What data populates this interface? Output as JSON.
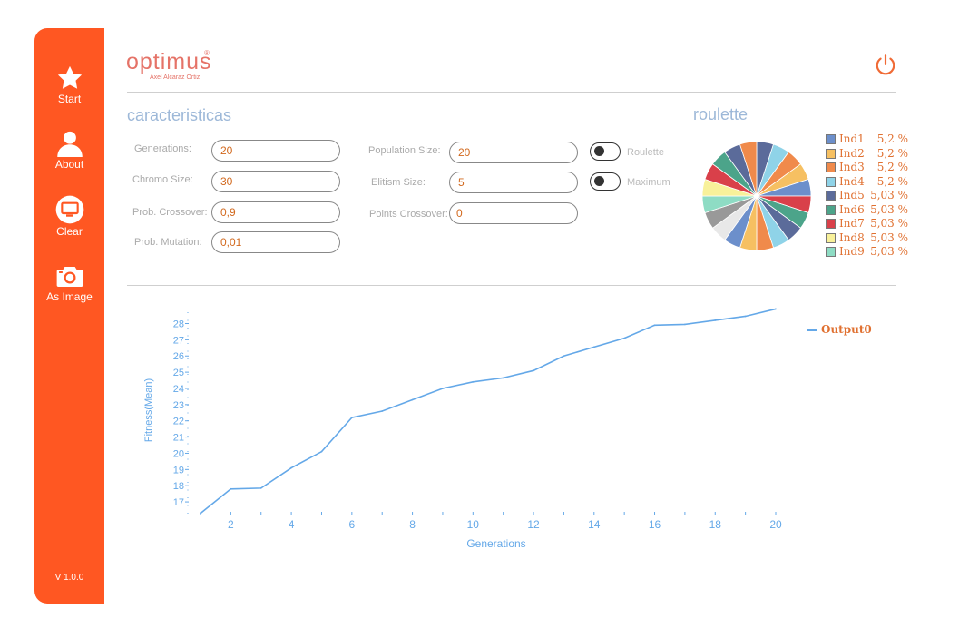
{
  "sidebar": {
    "items": [
      {
        "label": "Start",
        "icon": "star-icon"
      },
      {
        "label": "About",
        "icon": "user-icon"
      },
      {
        "label": "Clear",
        "icon": "monitor-icon"
      },
      {
        "label": "As Image",
        "icon": "camera-icon"
      }
    ],
    "version": "V 1.0.0"
  },
  "header": {
    "logo_text": "optimus",
    "logo_sub": "Axel Alcaraz Ortiz",
    "logo_reg": "®",
    "power_icon": "power-icon"
  },
  "caracteristicas": {
    "title": "caracteristicas",
    "generations": {
      "label": "Generations:",
      "value": "20"
    },
    "chromo_size": {
      "label": "Chromo Size:",
      "value": "30"
    },
    "prob_crossover": {
      "label": "Prob. Crossover:",
      "value": "0,9"
    },
    "prob_mutation": {
      "label": "Prob. Mutation:",
      "value": "0,01"
    },
    "population_size": {
      "label": "Population Size:",
      "value": "20"
    },
    "elitism_size": {
      "label": "Elitism Size:",
      "value": "5"
    },
    "points_crossover": {
      "label": "Points Crossover:",
      "value": "0"
    },
    "roulette_toggle": {
      "label": "Roulette",
      "on": false
    },
    "maximum_toggle": {
      "label": "Maximum",
      "on": false
    }
  },
  "roulette": {
    "title": "roulette",
    "legend": [
      {
        "name": "Ind1",
        "value": "5,2 %",
        "color": "#6C8FCB"
      },
      {
        "name": "Ind2",
        "value": "5,2 %",
        "color": "#F6C062"
      },
      {
        "name": "Ind3",
        "value": "5,2 %",
        "color": "#F08A4B"
      },
      {
        "name": "Ind4",
        "value": "5,2 %",
        "color": "#8FD3E8"
      },
      {
        "name": "Ind5",
        "value": "5,03 %",
        "color": "#5B6B9A"
      },
      {
        "name": "Ind6",
        "value": "5,03 %",
        "color": "#4CA48A"
      },
      {
        "name": "Ind7",
        "value": "5,03 %",
        "color": "#D9404A"
      },
      {
        "name": "Ind8",
        "value": "5,03 %",
        "color": "#F8F19A"
      },
      {
        "name": "Ind9",
        "value": "5,03 %",
        "color": "#8EDCC4"
      }
    ],
    "pie_colors": [
      "#5B6B9A",
      "#8FD3E8",
      "#F08A4B",
      "#F6C062",
      "#6C8FCB",
      "#D9404A",
      "#4CA48A",
      "#5B6B9A",
      "#8FD3E8",
      "#F08A4B",
      "#F6C062",
      "#6C8FCB",
      "#E8E8E8",
      "#999999",
      "#8EDCC4",
      "#F8F19A",
      "#D9404A",
      "#4CA48A",
      "#5B6B9A",
      "#F08A4B"
    ]
  },
  "chart_data": {
    "type": "line",
    "xlabel": "Generations",
    "ylabel": "Fitness(Mean)",
    "xlim": [
      1,
      20
    ],
    "ylim": [
      16.5,
      28.7
    ],
    "x_ticks": [
      2,
      4,
      6,
      8,
      10,
      12,
      14,
      16,
      18,
      20
    ],
    "y_ticks": [
      17,
      18,
      19,
      20,
      21,
      22,
      23,
      24,
      25,
      26,
      27,
      28
    ],
    "series": [
      {
        "name": "Output0",
        "color": "#64A8E8",
        "x": [
          1,
          2,
          3,
          4,
          5,
          6,
          7,
          8,
          9,
          10,
          11,
          12,
          13,
          14,
          15,
          16,
          17,
          18,
          19,
          20
        ],
        "values": [
          16.3,
          17.8,
          17.85,
          19.1,
          20.1,
          22.2,
          22.6,
          23.3,
          24.0,
          24.4,
          24.65,
          25.1,
          26.0,
          26.55,
          27.1,
          27.9,
          27.95,
          28.2,
          28.45,
          28.9
        ]
      }
    ]
  }
}
